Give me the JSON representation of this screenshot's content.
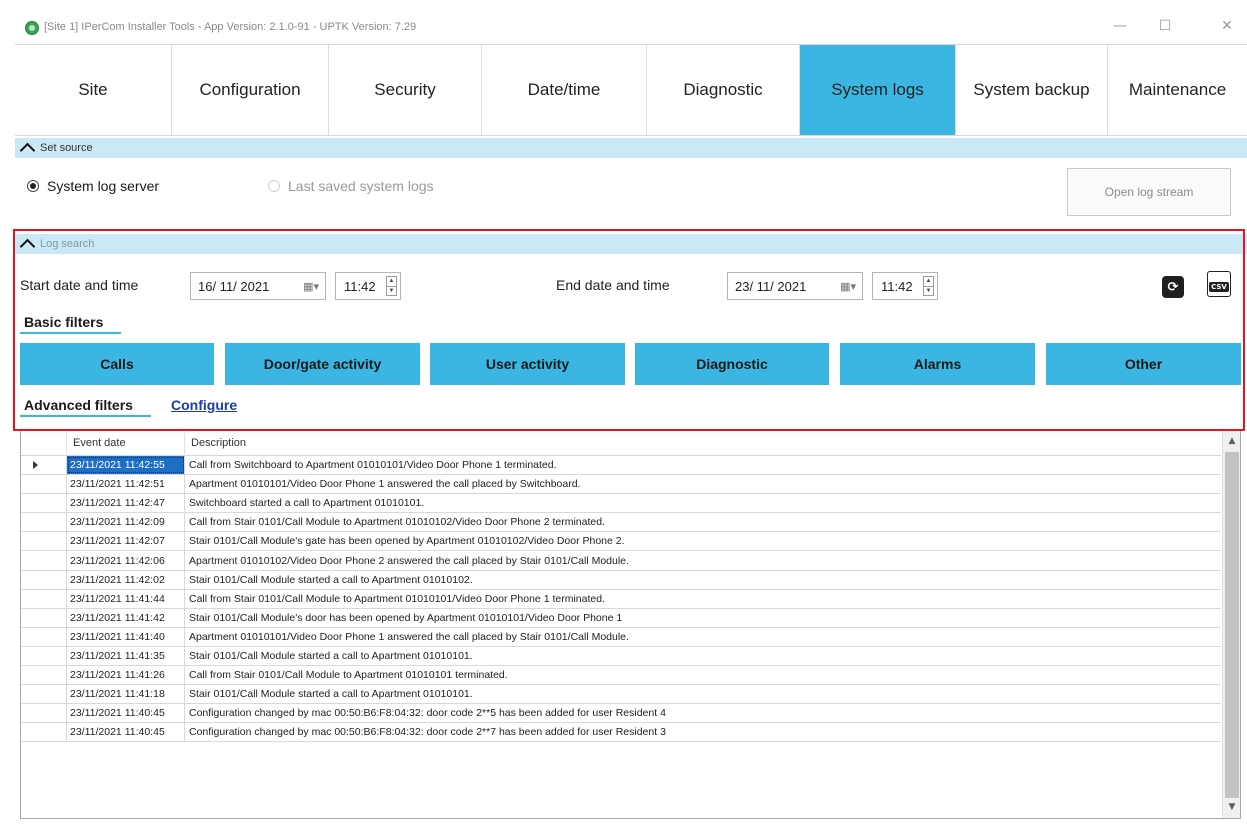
{
  "window": {
    "title": "[Site 1] IPerCom Installer Tools - App Version: 2.1.0-91 - UPTK Version: 7.29",
    "minimize": "—",
    "maximize": "☐",
    "close": "✕"
  },
  "tabs": [
    {
      "label": "Site",
      "active": false
    },
    {
      "label": "Configuration",
      "active": false
    },
    {
      "label": "Security",
      "active": false
    },
    {
      "label": "Date/time",
      "active": false
    },
    {
      "label": "Diagnostic",
      "active": false
    },
    {
      "label": "System logs",
      "active": true
    },
    {
      "label": "System backup",
      "active": false
    },
    {
      "label": "Maintenance",
      "active": false
    }
  ],
  "source": {
    "header": "Set source",
    "options": [
      {
        "label": "System log server",
        "selected": true,
        "enabled": true
      },
      {
        "label": "Last saved system logs",
        "selected": false,
        "enabled": false
      }
    ],
    "open_button": "Open log stream"
  },
  "log_search": {
    "header": "Log search",
    "start_label": "Start date and time",
    "start_date": "16/ 11/ 2021",
    "start_time": "11:42",
    "end_label": "End date and time",
    "end_date": "23/ 11/ 2021",
    "end_time": "11:42",
    "refresh_icon": "refresh-icon",
    "csv_icon": "csv-export-icon",
    "csv_badge": "CSV"
  },
  "basic_filters": {
    "title": "Basic filters",
    "buttons": [
      "Calls",
      "Door/gate activity",
      "User activity",
      "Diagnostic",
      "Alarms",
      "Other"
    ]
  },
  "advanced_filters": {
    "title": "Advanced filters",
    "configure_link": "Configure"
  },
  "grid": {
    "columns": [
      "Event date",
      "Description"
    ],
    "rows": [
      {
        "date": "23/11/2021 11:42:55",
        "desc": "Call from Switchboard to Apartment 01010101/Video Door Phone 1 terminated."
      },
      {
        "date": "23/11/2021 11:42:51",
        "desc": "Apartment 01010101/Video Door Phone 1 answered the call placed by Switchboard."
      },
      {
        "date": "23/11/2021 11:42:47",
        "desc": "Switchboard started a call to Apartment 01010101."
      },
      {
        "date": "23/11/2021 11:42:09",
        "desc": "Call from Stair 0101/Call Module to Apartment 01010102/Video Door Phone 2 terminated."
      },
      {
        "date": "23/11/2021 11:42:07",
        "desc": "Stair 0101/Call Module's gate has been opened by Apartment 01010102/Video Door Phone 2."
      },
      {
        "date": "23/11/2021 11:42:06",
        "desc": "Apartment 01010102/Video Door Phone 2 answered the call placed by Stair 0101/Call Module."
      },
      {
        "date": "23/11/2021 11:42:02",
        "desc": "Stair 0101/Call Module started a call to Apartment 01010102."
      },
      {
        "date": "23/11/2021 11:41:44",
        "desc": "Call from Stair 0101/Call Module to Apartment 01010101/Video Door Phone 1 terminated."
      },
      {
        "date": "23/11/2021 11:41:42",
        "desc": "Stair 0101/Call Module's door has been opened by Apartment 01010101/Video Door Phone 1"
      },
      {
        "date": "23/11/2021 11:41:40",
        "desc": "Apartment 01010101/Video Door Phone 1 answered the call placed by Stair 0101/Call Module."
      },
      {
        "date": "23/11/2021 11:41:35",
        "desc": "Stair 0101/Call Module started a call to Apartment 01010101."
      },
      {
        "date": "23/11/2021 11:41:26",
        "desc": "Call from Stair 0101/Call Module to Apartment 01010101 terminated."
      },
      {
        "date": "23/11/2021 11:41:18",
        "desc": "Stair 0101/Call Module started a call to Apartment 01010101."
      },
      {
        "date": "23/11/2021 11:40:45",
        "desc": "Configuration changed by mac 00:50:B6:F8:04:32: door code 2**5 has been added for user Resident 4"
      },
      {
        "date": "23/11/2021 11:40:45",
        "desc": "Configuration changed by mac 00:50:B6:F8:04:32: door code 2**7 has been added for user Resident 3"
      }
    ]
  },
  "colors": {
    "accent": "#3bb6e2",
    "section_header": "#cbe9f5",
    "highlight_border": "#e8141c",
    "row_selected": "#1e6fc4",
    "link": "#1c3d9e"
  }
}
